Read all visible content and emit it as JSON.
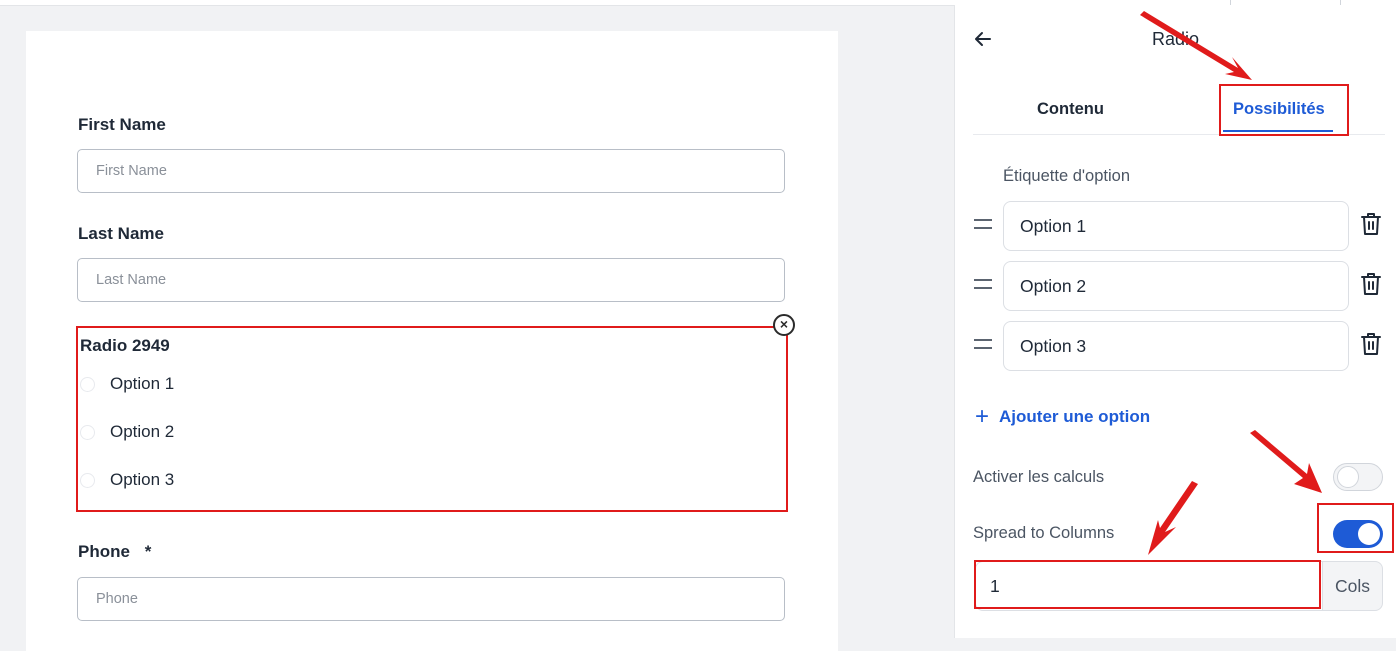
{
  "form": {
    "first_name": {
      "label": "First Name",
      "placeholder": "First Name"
    },
    "last_name": {
      "label": "Last Name",
      "placeholder": "Last Name"
    },
    "radio_field": {
      "title": "Radio 2949",
      "options": [
        "Option 1",
        "Option 2",
        "Option 3"
      ]
    },
    "phone": {
      "label": "Phone",
      "required_marker": "*",
      "placeholder": "Phone"
    }
  },
  "panel": {
    "back_icon": "arrow-left-icon",
    "title": "Radio",
    "tabs": [
      {
        "label": "Contenu",
        "active": false
      },
      {
        "label": "Possibilités",
        "active": true
      }
    ],
    "option_label_heading": "Étiquette d'option",
    "options": [
      "Option 1",
      "Option 2",
      "Option 3"
    ],
    "add_option_label": "Ajouter une option",
    "enable_calculations": {
      "label": "Activer les calculs",
      "enabled": false
    },
    "spread_to_columns": {
      "label": "Spread to Columns",
      "enabled": true
    },
    "columns": {
      "value": "1",
      "suffix": "Cols"
    }
  },
  "colors": {
    "accent": "#1e5bd6",
    "annotation": "#e01b1b"
  }
}
